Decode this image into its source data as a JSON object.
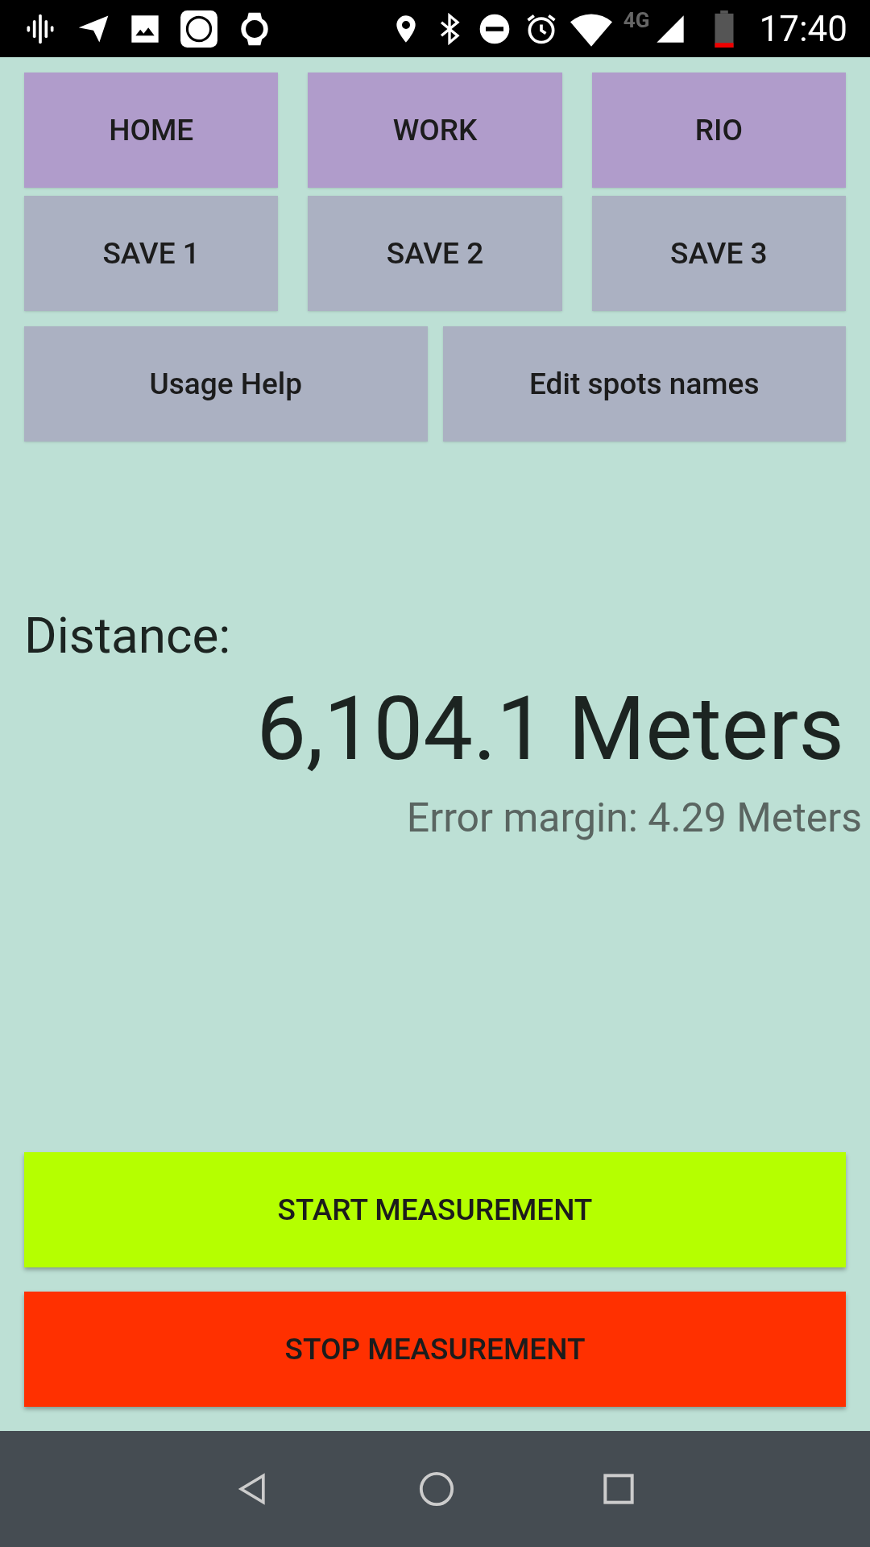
{
  "status_bar": {
    "network": "4G",
    "time": "17:40"
  },
  "spot_buttons": [
    {
      "label": "HOME",
      "kind": "spot"
    },
    {
      "label": "WORK",
      "kind": "spot"
    },
    {
      "label": "RIO",
      "kind": "spot"
    },
    {
      "label": "SAVE 1",
      "kind": "save"
    },
    {
      "label": "SAVE 2",
      "kind": "save"
    },
    {
      "label": "SAVE 3",
      "kind": "save"
    }
  ],
  "action_buttons": [
    "Usage Help",
    "Edit spots names"
  ],
  "distance": {
    "label": "Distance:",
    "value": "6,104.1 Meters",
    "error_margin": "Error margin: 4.29 Meters"
  },
  "measure_buttons": [
    {
      "label": "START MEASUREMENT",
      "kind": "start"
    },
    {
      "label": "STOP MEASUREMENT",
      "kind": "stop"
    }
  ]
}
